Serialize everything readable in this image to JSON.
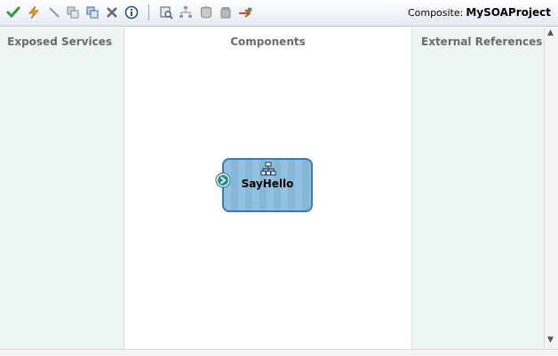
{
  "toolbar": {
    "buttons": [
      {
        "name": "validate-icon",
        "color": "#2e9a2e"
      },
      {
        "name": "lightning-icon",
        "color": "#e8a41c"
      },
      {
        "name": "wire-icon",
        "color": "#9a9a9a"
      },
      {
        "name": "copy-icon",
        "color": "#7a8a9a"
      },
      {
        "name": "paste-icon",
        "color": "#3b6cb0"
      },
      {
        "name": "delete-icon",
        "color": "#6a6a6a"
      },
      {
        "name": "info-icon",
        "color": "#1f4fa0"
      },
      {
        "name": "search-composite-icon",
        "color": "#4a5a70"
      },
      {
        "name": "layout-icon",
        "color": "#8a8a8a"
      },
      {
        "name": "database-icon",
        "color": "#8a8a8a"
      },
      {
        "name": "jar-icon",
        "color": "#8a8a8a"
      },
      {
        "name": "deploy-icon",
        "color": "#d24a1f"
      }
    ],
    "composite_label": "Composite:",
    "composite_name": "MySOAProject"
  },
  "columns": {
    "exposed_services": "Exposed Services",
    "components": "Components",
    "external_references": "External References"
  },
  "component": {
    "name": "SayHello",
    "icon": "bpel-process-icon",
    "color": "#92c2de"
  }
}
